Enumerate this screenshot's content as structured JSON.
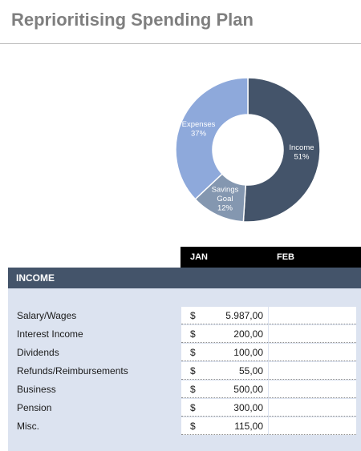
{
  "title": "Reprioritising Spending Plan",
  "chart_data": {
    "type": "pie",
    "title": "",
    "slices": [
      {
        "label": "Income",
        "percent_label": "51%",
        "value": 51,
        "color": "#44546a"
      },
      {
        "label": "Savings Goal",
        "percent_label": "12%",
        "value": 12,
        "color": "#8497b0"
      },
      {
        "label": "Expenses",
        "percent_label": "37%",
        "value": 37,
        "color": "#8ea9db"
      }
    ]
  },
  "months": [
    "JAN",
    "FEB"
  ],
  "income": {
    "header": "INCOME",
    "currency_symbol": "$",
    "rows": [
      {
        "label": "Salary/Wages",
        "amount": "5.987,00"
      },
      {
        "label": "Interest Income",
        "amount": "200,00"
      },
      {
        "label": "Dividends",
        "amount": "100,00"
      },
      {
        "label": "Refunds/Reimbursements",
        "amount": "55,00"
      },
      {
        "label": "Business",
        "amount": "500,00"
      },
      {
        "label": "Pension",
        "amount": "300,00"
      },
      {
        "label": "Misc.",
        "amount": "115,00"
      }
    ]
  }
}
